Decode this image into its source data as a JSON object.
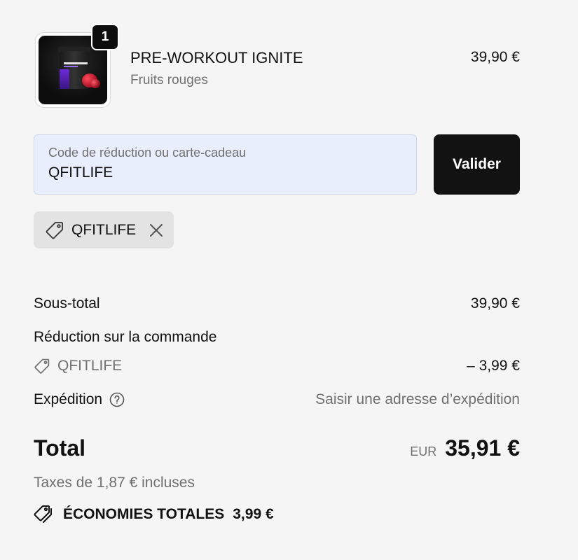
{
  "product": {
    "name": "PRE-WORKOUT IGNITE",
    "variant": "Fruits rouges",
    "price": "39,90 €",
    "quantity": "1"
  },
  "discount": {
    "label": "Code de réduction ou carte-cadeau",
    "value": "QFITLIFE",
    "apply_label": "Valider",
    "applied_code": "QFITLIFE"
  },
  "summary": {
    "subtotal_label": "Sous-total",
    "subtotal_value": "39,90 €",
    "order_discount_label": "Réduction sur la commande",
    "order_discount_code": "QFITLIFE",
    "order_discount_value": "– 3,99 €",
    "shipping_label": "Expédition",
    "shipping_value": "Saisir une adresse d’expédition",
    "total_label": "Total",
    "currency": "EUR",
    "total_value": "35,91 €",
    "taxes_text": "Taxes de 1,87 € incluses",
    "savings_label": "ÉCONOMIES TOTALES",
    "savings_value": "3,99 €"
  },
  "colors": {
    "background": "#f5f5f5",
    "field_bg": "#e8eefc",
    "button_bg": "#121212",
    "tag_bg": "#e3e3e3",
    "muted_text": "#707070"
  }
}
